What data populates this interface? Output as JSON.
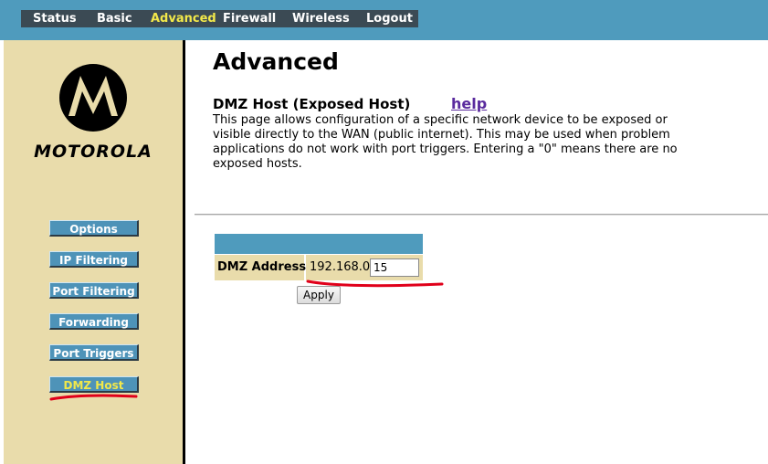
{
  "top_nav": {
    "tabs": [
      {
        "label": "Status"
      },
      {
        "label": "Basic"
      },
      {
        "label": "Advanced",
        "active": true
      },
      {
        "label": "Firewall"
      },
      {
        "label": "Wireless"
      },
      {
        "label": "Logout"
      }
    ]
  },
  "sidebar": {
    "brand": "MOTOROLA",
    "logo_icon": "motorola-batwing-icon",
    "items": [
      {
        "label": "Options"
      },
      {
        "label": "IP Filtering"
      },
      {
        "label": "Port Filtering"
      },
      {
        "label": "Forwarding"
      },
      {
        "label": "Port Triggers"
      },
      {
        "label": "DMZ Host",
        "active": true
      }
    ]
  },
  "main": {
    "page_title": "Advanced",
    "section_title": "DMZ Host (Exposed Host)",
    "help_link": "help",
    "description": "This page allows configuration of a specific network device to be exposed or visible directly to the WAN (public internet).  This may be used when problem applications do not work with port triggers.  Entering a \"0\" means there are no exposed hosts.",
    "dmz": {
      "label": "DMZ Address",
      "prefix": "192.168.0.",
      "value": "15"
    },
    "apply_label": "Apply"
  },
  "colors": {
    "nav_bar": "#4f9bbd",
    "nav_tabs_bg": "#3b4a54",
    "active_text": "#f2e84a",
    "sidebar_bg": "#e9dcab",
    "button_blue": "#4e93b8",
    "help_link": "#5a2b9e",
    "annotation_red": "#e0001a"
  }
}
